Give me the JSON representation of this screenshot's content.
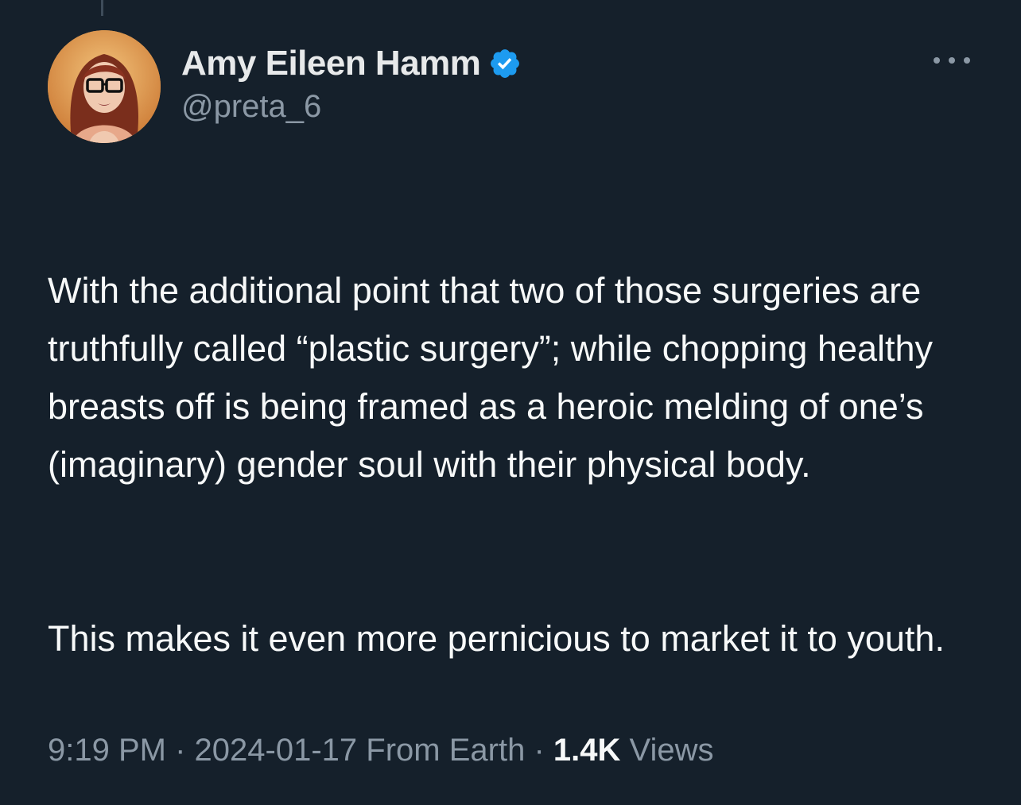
{
  "author": {
    "display_name": "Amy Eileen Hamm",
    "handle": "@preta_6",
    "verified_icon": "verified-badge-icon",
    "avatar_icon": "profile-photo"
  },
  "tweet": {
    "paragraphs": [
      "With the additional point that two of those surgeries are truthfully called “plastic surgery”; while chopping healthy breasts off is being framed as a heroic melding of one’s (imaginary) gender soul with their physical body.",
      "This makes it even more pernicious to market it to youth."
    ]
  },
  "meta": {
    "time": "9:19 PM",
    "separator": "·",
    "date": "2024-01-17",
    "source": "From Earth",
    "views_count": "1.4K",
    "views_label": "Views"
  },
  "colors": {
    "background": "#15202b",
    "text": "#e7e9ea",
    "muted": "#8b98a5",
    "verified": "#1d9bf0"
  }
}
